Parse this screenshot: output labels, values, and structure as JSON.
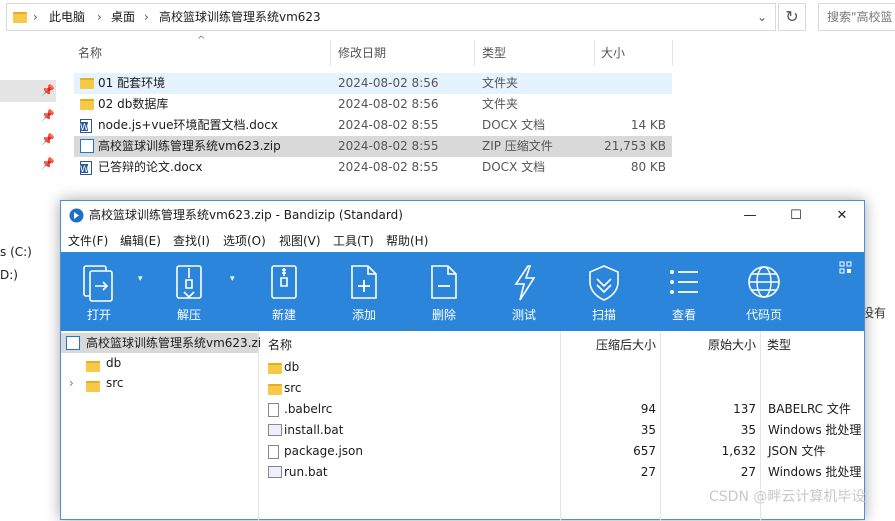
{
  "explorer": {
    "breadcrumb": [
      "此电脑",
      "桌面",
      "高校篮球训练管理系统vm623"
    ],
    "search_placeholder": "搜索\"高校篮",
    "columns": {
      "name": "名称",
      "date": "修改日期",
      "type": "类型",
      "size": "大小"
    },
    "rows": [
      {
        "name": "01  配套环境",
        "date": "2024-08-02 8:56",
        "type": "文件夹",
        "size": "",
        "icon": "folder-icon"
      },
      {
        "name": "02 db数据库",
        "date": "2024-08-02 8:56",
        "type": "文件夹",
        "size": "",
        "icon": "folder-icon"
      },
      {
        "name": "node.js+vue环境配置文档.docx",
        "date": "2024-08-02 8:55",
        "type": "DOCX 文档",
        "size": "14 KB",
        "icon": "word-doc-icon"
      },
      {
        "name": "高校篮球训练管理系统vm623.zip",
        "date": "2024-08-02 8:55",
        "type": "ZIP 压缩文件",
        "size": "21,753 KB",
        "icon": "zip-icon"
      },
      {
        "name": "已答辩的论文.docx",
        "date": "2024-08-02 8:55",
        "type": "DOCX 文档",
        "size": "80 KB",
        "icon": "word-doc-icon"
      }
    ],
    "left_drives": [
      "s (C:)",
      "D:)"
    ],
    "right_clip": "没有"
  },
  "bandizip": {
    "title": "高校篮球训练管理系统vm623.zip - Bandizip (Standard)",
    "window_buttons": {
      "minimize": "—",
      "maximize": "☐",
      "close": "✕"
    },
    "menu": [
      "文件(F)",
      "编辑(E)",
      "查找(I)",
      "选项(O)",
      "视图(V)",
      "工具(T)",
      "帮助(H)"
    ],
    "toolbar": [
      {
        "label": "打开",
        "icon": "open-icon"
      },
      {
        "label": "解压",
        "icon": "extract-icon"
      },
      {
        "label": "新建",
        "icon": "new-archive-icon"
      },
      {
        "label": "添加",
        "icon": "add-file-icon"
      },
      {
        "label": "删除",
        "icon": "delete-file-icon"
      },
      {
        "label": "测试",
        "icon": "lightning-icon"
      },
      {
        "label": "扫描",
        "icon": "shield-icon"
      },
      {
        "label": "查看",
        "icon": "list-view-icon"
      },
      {
        "label": "代码页",
        "icon": "globe-icon"
      }
    ],
    "tree": [
      {
        "label": "高校篮球训练管理系统vm623.zi",
        "icon": "zip-icon"
      },
      {
        "label": "db",
        "icon": "folder-icon"
      },
      {
        "label": "src",
        "icon": "folder-icon"
      }
    ],
    "columns": {
      "name": "名称",
      "compressed": "压缩后大小",
      "original": "原始大小",
      "type": "类型"
    },
    "rows": [
      {
        "name": "db",
        "compressed": "",
        "original": "",
        "type": "",
        "icon": "folder-icon"
      },
      {
        "name": "src",
        "compressed": "",
        "original": "",
        "type": "",
        "icon": "folder-icon"
      },
      {
        "name": ".babelrc",
        "compressed": "94",
        "original": "137",
        "type": "BABELRC 文件",
        "icon": "file-icon"
      },
      {
        "name": "install.bat",
        "compressed": "35",
        "original": "35",
        "type": "Windows 批处理",
        "icon": "batch-file-icon"
      },
      {
        "name": "package.json",
        "compressed": "657",
        "original": "1,632",
        "type": "JSON 文件",
        "icon": "file-icon"
      },
      {
        "name": "run.bat",
        "compressed": "27",
        "original": "27",
        "type": "Windows 批处理",
        "icon": "batch-file-icon"
      }
    ]
  },
  "watermark": "CSDN @畔云计算机毕设",
  "colors": {
    "toolbar_blue": "#2b86db",
    "selection": "#cce8ff",
    "selected_row": "#d9d9d9",
    "folder": "#f7c948"
  }
}
